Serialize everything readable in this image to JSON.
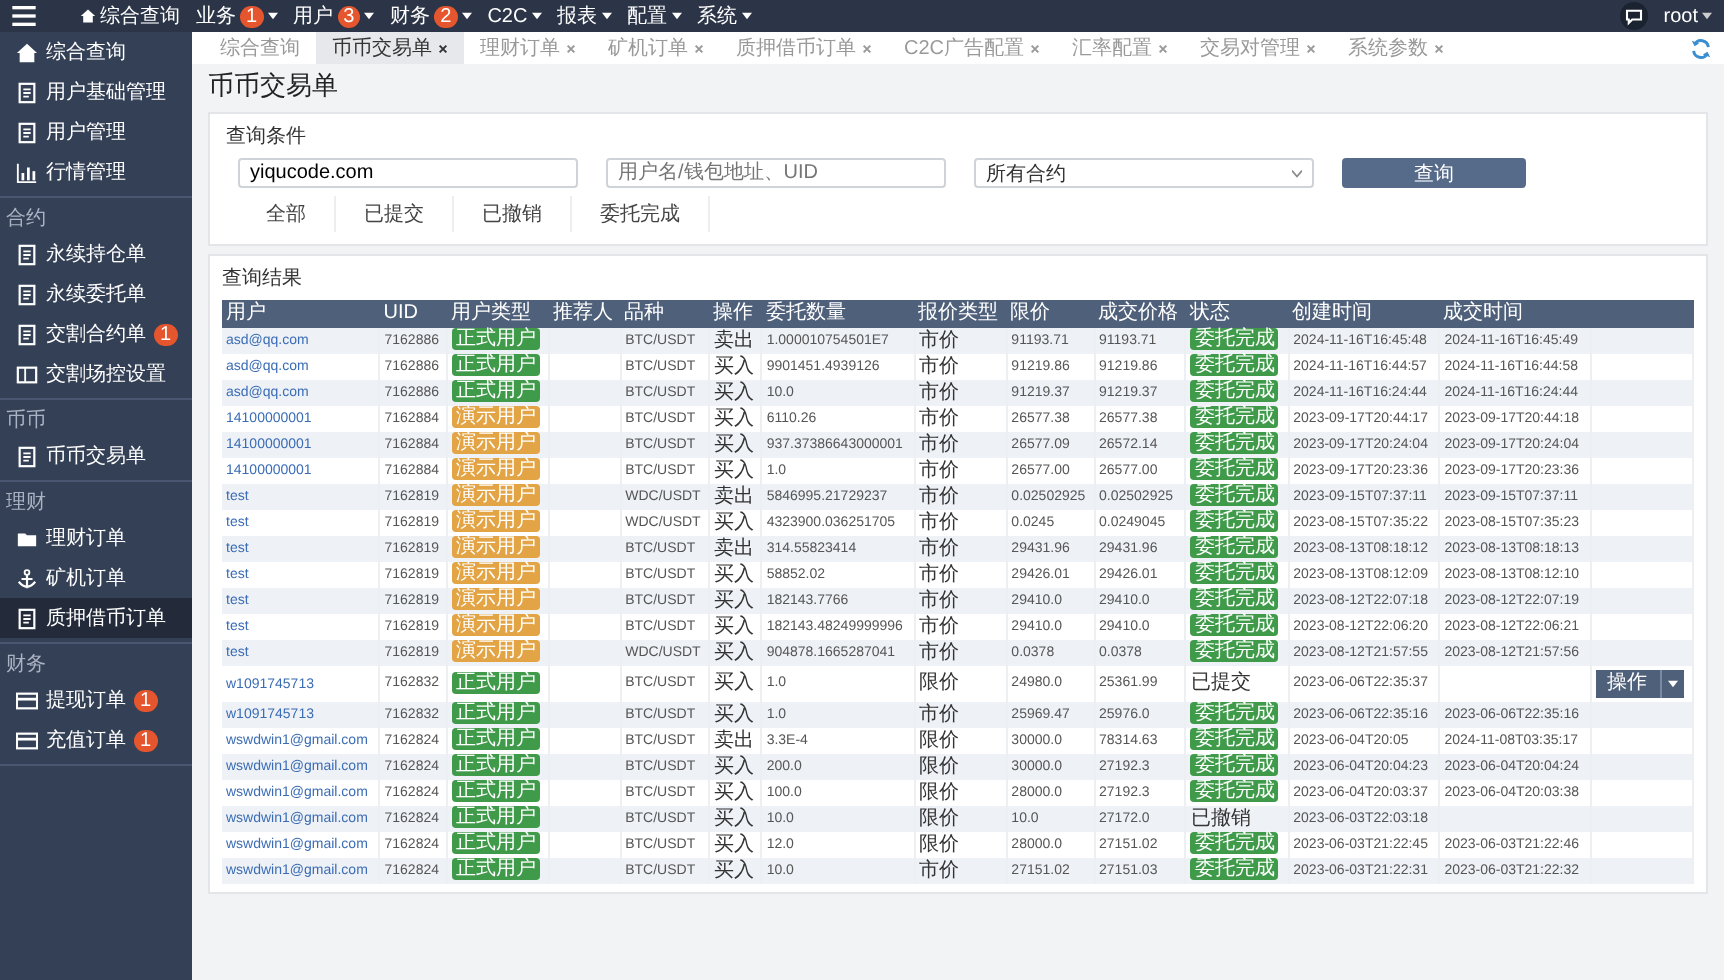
{
  "top_nav": {
    "items": [
      {
        "kind": "home",
        "label": "综合查询"
      },
      {
        "kind": "menu",
        "label": "业务",
        "badge": "1"
      },
      {
        "kind": "menu",
        "label": "用户",
        "badge": "3"
      },
      {
        "kind": "menu",
        "label": "财务",
        "badge": "2"
      },
      {
        "kind": "menu",
        "label": "C2C"
      },
      {
        "kind": "menu",
        "label": "报表"
      },
      {
        "kind": "menu",
        "label": "配置"
      },
      {
        "kind": "menu",
        "label": "系统"
      }
    ],
    "user": "root"
  },
  "sidebar": {
    "sections": [
      {
        "items": [
          {
            "label": "综合查询",
            "selected": false
          },
          {
            "label": "用户基础管理",
            "selected": false
          },
          {
            "label": "用户管理",
            "selected": false
          },
          {
            "label": "行情管理",
            "selected": false
          }
        ]
      },
      {
        "title": "合约",
        "items": [
          {
            "label": "永续持仓单",
            "selected": false
          },
          {
            "label": "永续委托单",
            "selected": false
          },
          {
            "label": "交割合约单",
            "badge": "1",
            "selected": false
          },
          {
            "label": "交割场控设置",
            "selected": false
          }
        ]
      },
      {
        "title": "币币",
        "items": [
          {
            "label": "币币交易单",
            "selected": false
          }
        ]
      },
      {
        "title": "理财",
        "items": [
          {
            "label": "理财订单",
            "selected": false
          },
          {
            "label": "矿机订单",
            "selected": false
          },
          {
            "label": "质押借币订单",
            "selected": true
          }
        ]
      },
      {
        "title": "财务",
        "items": [
          {
            "label": "提现订单",
            "badge": "1",
            "selected": false
          },
          {
            "label": "充值订单",
            "badge": "1",
            "selected": false
          }
        ]
      }
    ]
  },
  "tabs": [
    {
      "label": "综合查询",
      "closable": false,
      "selected": false
    },
    {
      "label": "币币交易单",
      "closable": true,
      "selected": true
    },
    {
      "label": "理财订单",
      "closable": true,
      "selected": false
    },
    {
      "label": "矿机订单",
      "closable": true,
      "selected": false
    },
    {
      "label": "质押借币订单",
      "closable": true,
      "selected": false
    },
    {
      "label": "C2C广告配置",
      "closable": true,
      "selected": false
    },
    {
      "label": "汇率配置",
      "closable": true,
      "selected": false
    },
    {
      "label": "交易对管理",
      "closable": true,
      "selected": false
    },
    {
      "label": "系统参数",
      "closable": true,
      "selected": false
    }
  ],
  "page_title": "币币交易单",
  "query": {
    "title": "查询条件",
    "keyword": {
      "value": "yiqucode.com"
    },
    "user": {
      "placeholder": "用户名/钱包地址、UID"
    },
    "contract": {
      "value": "所有合约"
    },
    "button": "查询",
    "filters": [
      {
        "label": "全部",
        "selected": false
      },
      {
        "label": "已提交",
        "selected": false
      },
      {
        "label": "已撤销",
        "selected": false
      },
      {
        "label": "委托完成",
        "selected": false
      }
    ]
  },
  "results": {
    "title": "查询结果",
    "columns": [
      "用户",
      "UID",
      "用户类型",
      "推荐人",
      "品种",
      "操作",
      "委托数量",
      "报价类型",
      "限价",
      "成交价格",
      "状态",
      "创建时间",
      "成交时间"
    ],
    "rows": [
      {
        "user": "asd@qq.com",
        "uid": "7162886",
        "type": {
          "text": "正式用户",
          "color": "#3f9a4a"
        },
        "pair": "BTC/USDT",
        "side": "卖出",
        "qty": "1.000010754501E7",
        "price_type": "市价",
        "limit": "91193.71",
        "deal": "91193.71",
        "status": {
          "kind": "badge",
          "text": "委托完成"
        },
        "created": "2024-11-16T16:45:48",
        "filled": "2024-11-16T16:45:49"
      },
      {
        "user": "asd@qq.com",
        "uid": "7162886",
        "type": {
          "text": "正式用户",
          "color": "#3f9a4a"
        },
        "pair": "BTC/USDT",
        "side": "买入",
        "qty": "9901451.4939126",
        "price_type": "市价",
        "limit": "91219.86",
        "deal": "91219.86",
        "status": {
          "kind": "badge",
          "text": "委托完成"
        },
        "created": "2024-11-16T16:44:57",
        "filled": "2024-11-16T16:44:58"
      },
      {
        "user": "asd@qq.com",
        "uid": "7162886",
        "type": {
          "text": "正式用户",
          "color": "#3f9a4a"
        },
        "pair": "BTC/USDT",
        "side": "买入",
        "qty": "10.0",
        "price_type": "市价",
        "limit": "91219.37",
        "deal": "91219.37",
        "status": {
          "kind": "badge",
          "text": "委托完成"
        },
        "created": "2024-11-16T16:24:44",
        "filled": "2024-11-16T16:24:44"
      },
      {
        "user": "14100000001",
        "uid": "7162884",
        "type": {
          "text": "演示用户",
          "color": "#e2a444"
        },
        "pair": "BTC/USDT",
        "side": "买入",
        "qty": "6110.26",
        "price_type": "市价",
        "limit": "26577.38",
        "deal": "26577.38",
        "status": {
          "kind": "badge",
          "text": "委托完成"
        },
        "created": "2023-09-17T20:44:17",
        "filled": "2023-09-17T20:44:18"
      },
      {
        "user": "14100000001",
        "uid": "7162884",
        "type": {
          "text": "演示用户",
          "color": "#e2a444"
        },
        "pair": "BTC/USDT",
        "side": "买入",
        "qty": "937.37386643000001",
        "price_type": "市价",
        "limit": "26577.09",
        "deal": "26572.14",
        "status": {
          "kind": "badge",
          "text": "委托完成"
        },
        "created": "2023-09-17T20:24:04",
        "filled": "2023-09-17T20:24:04"
      },
      {
        "user": "14100000001",
        "uid": "7162884",
        "type": {
          "text": "演示用户",
          "color": "#e2a444"
        },
        "pair": "BTC/USDT",
        "side": "买入",
        "qty": "1.0",
        "price_type": "市价",
        "limit": "26577.00",
        "deal": "26577.00",
        "status": {
          "kind": "badge",
          "text": "委托完成"
        },
        "created": "2023-09-17T20:23:36",
        "filled": "2023-09-17T20:23:36"
      },
      {
        "user": "test",
        "uid": "7162819",
        "type": {
          "text": "演示用户",
          "color": "#e2a444"
        },
        "pair": "WDC/USDT",
        "side": "卖出",
        "qty": "5846995.21729237",
        "price_type": "市价",
        "limit": "0.02502925",
        "deal": "0.02502925",
        "status": {
          "kind": "badge",
          "text": "委托完成"
        },
        "created": "2023-09-15T07:37:11",
        "filled": "2023-09-15T07:37:11"
      },
      {
        "user": "test",
        "uid": "7162819",
        "type": {
          "text": "演示用户",
          "color": "#e2a444"
        },
        "pair": "WDC/USDT",
        "side": "买入",
        "qty": "4323900.036251705",
        "price_type": "市价",
        "limit": "0.0245",
        "deal": "0.0249045",
        "status": {
          "kind": "badge",
          "text": "委托完成"
        },
        "created": "2023-08-15T07:35:22",
        "filled": "2023-08-15T07:35:23"
      },
      {
        "user": "test",
        "uid": "7162819",
        "type": {
          "text": "演示用户",
          "color": "#e2a444"
        },
        "pair": "BTC/USDT",
        "side": "卖出",
        "qty": "314.55823414",
        "price_type": "市价",
        "limit": "29431.96",
        "deal": "29431.96",
        "status": {
          "kind": "badge",
          "text": "委托完成"
        },
        "created": "2023-08-13T08:18:12",
        "filled": "2023-08-13T08:18:13"
      },
      {
        "user": "test",
        "uid": "7162819",
        "type": {
          "text": "演示用户",
          "color": "#e2a444"
        },
        "pair": "BTC/USDT",
        "side": "买入",
        "qty": "58852.02",
        "price_type": "市价",
        "limit": "29426.01",
        "deal": "29426.01",
        "status": {
          "kind": "badge",
          "text": "委托完成"
        },
        "created": "2023-08-13T08:12:09",
        "filled": "2023-08-13T08:12:10"
      },
      {
        "user": "test",
        "uid": "7162819",
        "type": {
          "text": "演示用户",
          "color": "#e2a444"
        },
        "pair": "BTC/USDT",
        "side": "买入",
        "qty": "182143.7766",
        "price_type": "市价",
        "limit": "29410.0",
        "deal": "29410.0",
        "status": {
          "kind": "badge",
          "text": "委托完成"
        },
        "created": "2023-08-12T22:07:18",
        "filled": "2023-08-12T22:07:19"
      },
      {
        "user": "test",
        "uid": "7162819",
        "type": {
          "text": "演示用户",
          "color": "#e2a444"
        },
        "pair": "BTC/USDT",
        "side": "买入",
        "qty": "182143.48249999996",
        "price_type": "市价",
        "limit": "29410.0",
        "deal": "29410.0",
        "status": {
          "kind": "badge",
          "text": "委托完成"
        },
        "created": "2023-08-12T22:06:20",
        "filled": "2023-08-12T22:06:21"
      },
      {
        "user": "test",
        "uid": "7162819",
        "type": {
          "text": "演示用户",
          "color": "#e2a444"
        },
        "pair": "WDC/USDT",
        "side": "买入",
        "qty": "904878.1665287041",
        "price_type": "市价",
        "limit": "0.0378",
        "deal": "0.0378",
        "status": {
          "kind": "badge",
          "text": "委托完成"
        },
        "created": "2023-08-12T21:57:55",
        "filled": "2023-08-12T21:57:56"
      },
      {
        "user": "w1091745713",
        "uid": "7162832",
        "type": {
          "text": "正式用户",
          "color": "#3f9a4a"
        },
        "pair": "BTC/USDT",
        "side": "买入",
        "qty": "1.0",
        "price_type": "限价",
        "limit": "24980.0",
        "deal": "25361.99",
        "status": {
          "kind": "text",
          "text": "已提交"
        },
        "created": "2023-06-06T22:35:37",
        "action": "操作"
      },
      {
        "user": "w1091745713",
        "uid": "7162832",
        "type": {
          "text": "正式用户",
          "color": "#3f9a4a"
        },
        "pair": "BTC/USDT",
        "side": "买入",
        "qty": "1.0",
        "price_type": "市价",
        "limit": "25969.47",
        "deal": "25976.0",
        "status": {
          "kind": "badge",
          "text": "委托完成"
        },
        "created": "2023-06-06T22:35:16",
        "filled": "2023-06-06T22:35:16"
      },
      {
        "user": "wswdwin1@gmail.com",
        "uid": "7162824",
        "type": {
          "text": "正式用户",
          "color": "#3f9a4a"
        },
        "pair": "BTC/USDT",
        "side": "卖出",
        "qty": "3.3E-4",
        "price_type": "限价",
        "limit": "30000.0",
        "deal": "78314.63",
        "status": {
          "kind": "badge",
          "text": "委托完成"
        },
        "created": "2023-06-04T20:05",
        "filled": "2024-11-08T03:35:17"
      },
      {
        "user": "wswdwin1@gmail.com",
        "uid": "7162824",
        "type": {
          "text": "正式用户",
          "color": "#3f9a4a"
        },
        "pair": "BTC/USDT",
        "side": "买入",
        "qty": "200.0",
        "price_type": "限价",
        "limit": "30000.0",
        "deal": "27192.3",
        "status": {
          "kind": "badge",
          "text": "委托完成"
        },
        "created": "2023-06-04T20:04:23",
        "filled": "2023-06-04T20:04:24"
      },
      {
        "user": "wswdwin1@gmail.com",
        "uid": "7162824",
        "type": {
          "text": "正式用户",
          "color": "#3f9a4a"
        },
        "pair": "BTC/USDT",
        "side": "买入",
        "qty": "100.0",
        "price_type": "限价",
        "limit": "28000.0",
        "deal": "27192.3",
        "status": {
          "kind": "badge",
          "text": "委托完成"
        },
        "created": "2023-06-04T20:03:37",
        "filled": "2023-06-04T20:03:38"
      },
      {
        "user": "wswdwin1@gmail.com",
        "uid": "7162824",
        "type": {
          "text": "正式用户",
          "color": "#3f9a4a"
        },
        "pair": "BTC/USDT",
        "side": "买入",
        "qty": "10.0",
        "price_type": "限价",
        "limit": "10.0",
        "deal": "27172.0",
        "status": {
          "kind": "text",
          "text": "已撤销"
        },
        "created": "2023-06-03T22:03:18"
      },
      {
        "user": "wswdwin1@gmail.com",
        "uid": "7162824",
        "type": {
          "text": "正式用户",
          "color": "#3f9a4a"
        },
        "pair": "BTC/USDT",
        "side": "买入",
        "qty": "12.0",
        "price_type": "限价",
        "limit": "28000.0",
        "deal": "27151.02",
        "status": {
          "kind": "badge",
          "text": "委托完成"
        },
        "created": "2023-06-03T21:22:45",
        "filled": "2023-06-03T21:22:46"
      },
      {
        "user": "wswdwin1@gmail.com",
        "uid": "7162824",
        "type": {
          "text": "正式用户",
          "color": "#3f9a4a"
        },
        "pair": "BTC/USDT",
        "side": "买入",
        "qty": "10.0",
        "price_type": "市价",
        "limit": "27151.02",
        "deal": "27151.03",
        "status": {
          "kind": "badge",
          "text": "委托完成"
        },
        "created": "2023-06-03T21:22:31",
        "filled": "2023-06-03T21:22:32"
      }
    ]
  }
}
